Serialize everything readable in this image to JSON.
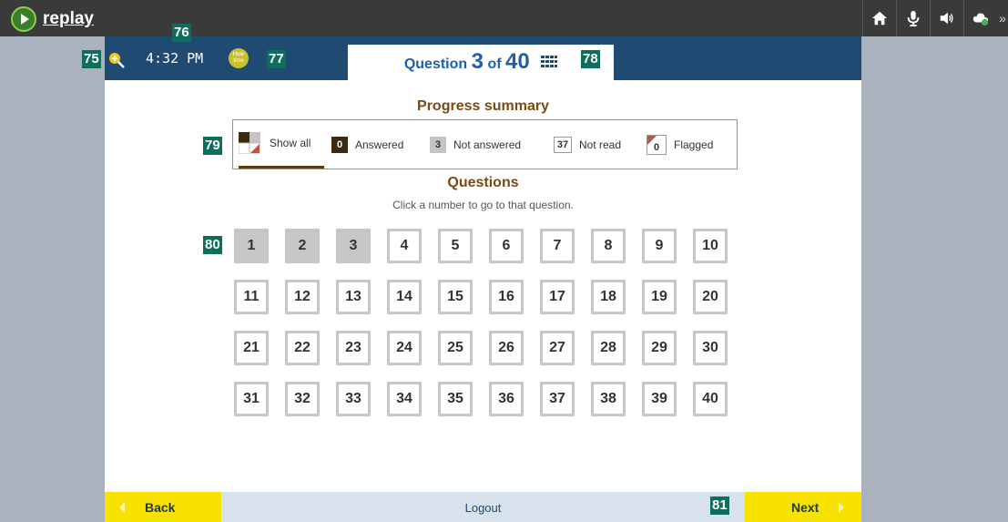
{
  "app": {
    "logo_text": "replay"
  },
  "appbar": {
    "icons": [
      "home-icon",
      "microphone-icon",
      "speaker-icon",
      "cloud-icon"
    ],
    "more_glyph": "»"
  },
  "toolbar": {
    "clock": "4:32 PM",
    "hide_time_label": "Hide time",
    "question_word": "Question",
    "question_current": "3",
    "of_word": "of",
    "question_total": "40"
  },
  "summary": {
    "title": "Progress summary",
    "filters": {
      "show_all": "Show all",
      "answered_count": "0",
      "answered_label": "Answered",
      "not_answered_count": "3",
      "not_answered_label": "Not answered",
      "not_read_count": "37",
      "not_read_label": "Not read",
      "flagged_count": "0",
      "flagged_label": "Flagged"
    }
  },
  "questions": {
    "title": "Questions",
    "subtitle": "Click a number to go to that question.",
    "numbers": [
      "1",
      "2",
      "3",
      "4",
      "5",
      "6",
      "7",
      "8",
      "9",
      "10",
      "11",
      "12",
      "13",
      "14",
      "15",
      "16",
      "17",
      "18",
      "19",
      "20",
      "21",
      "22",
      "23",
      "24",
      "25",
      "26",
      "27",
      "28",
      "29",
      "30",
      "31",
      "32",
      "33",
      "34",
      "35",
      "36",
      "37",
      "38",
      "39",
      "40"
    ],
    "visited": [
      "1",
      "2",
      "3"
    ]
  },
  "footer": {
    "back_label": "Back",
    "logout_label": "Logout",
    "next_label": "Next"
  },
  "badges": {
    "b75": "75",
    "b76": "76",
    "b77": "77",
    "b78": "78",
    "b79": "79",
    "b80": "80",
    "b81": "81"
  },
  "colors": {
    "toolbar": "#1f4a72",
    "accent_yellow": "#f7e200",
    "heading_brown": "#7a4a10",
    "badge_green": "#0d6e5c"
  }
}
